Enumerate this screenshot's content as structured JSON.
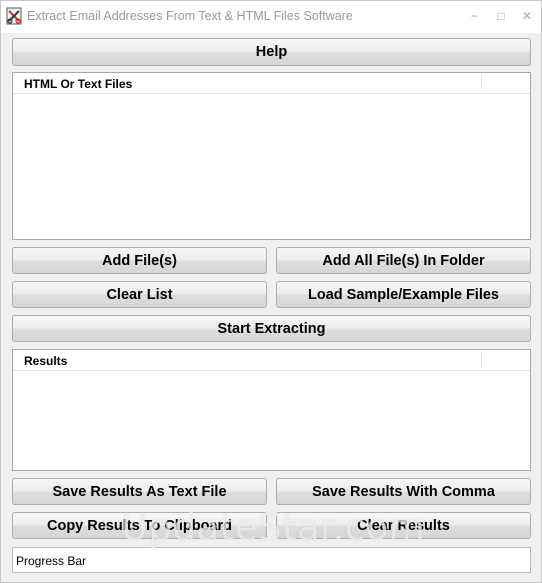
{
  "window": {
    "title": "Extract Email Addresses From Text & HTML Files Software",
    "controls": {
      "minimize": "−",
      "maximize": "□",
      "close": "✕"
    }
  },
  "buttons": {
    "help": "Help",
    "add_files": "Add File(s)",
    "add_folder": "Add All File(s) In Folder",
    "clear_list": "Clear List",
    "load_sample": "Load Sample/Example Files",
    "start_extracting": "Start Extracting",
    "save_text": "Save Results As Text File",
    "save_comma": "Save Results With Comma",
    "copy_clipboard": "Copy Results To Clipboard",
    "clear_results": "Clear Results"
  },
  "files_list": {
    "header": "HTML Or Text Files",
    "items": []
  },
  "results_list": {
    "header": "Results",
    "items": []
  },
  "progress": {
    "label": "Progress Bar"
  },
  "watermark": "UpdateStar.com",
  "icons": {
    "app": "scissors-app-icon",
    "minimize": "minimize-icon",
    "maximize": "maximize-icon",
    "close": "close-icon"
  }
}
